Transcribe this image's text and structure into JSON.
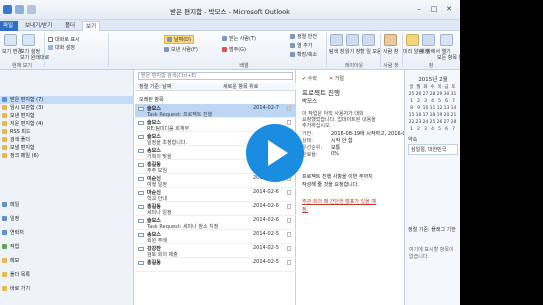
{
  "window": {
    "title": "받은 편지함 - 박모스 - Microsoft Outlook"
  },
  "tabs": {
    "file": "파일",
    "items": [
      "보내기/받기",
      "폴더",
      "보기"
    ]
  },
  "ribbon": {
    "groups": [
      "현재 보기",
      "배열",
      "레이아웃",
      "사람 창",
      "창"
    ],
    "labels": {
      "view_change": "보기 변경",
      "view_settings": "보기 설정",
      "view_reset": "보기 원래대로",
      "conversation": "대화로 표시",
      "conversation_settings": "대화 설정",
      "date": "날짜(D)",
      "sender": "보낸 사람(F)",
      "to": "받는 사람(T)",
      "recipient": "보낸 사람(E)",
      "category": "범주(G)",
      "reverse": "정렬 반전",
      "add_column": "열 추가",
      "expand": "확장/축소",
      "folder_pane": "탐색 창",
      "reading_pane": "읽기 창",
      "todo_bar": "할 일 모음",
      "people_pane": "사람 창",
      "reminders": "미리 알림 창",
      "new_window": "새 창에서 열기",
      "close_all": "모든 항목 닫기"
    }
  },
  "nav": {
    "items": [
      {
        "label": "받은 편지함 (7)",
        "icon": "inbox-icon",
        "selected": true
      },
      {
        "label": "임시 보관함 (3)",
        "icon": "drafts-icon"
      },
      {
        "label": "보낸 편지함",
        "icon": "sent-icon"
      },
      {
        "label": "지운 편지함 (4)",
        "icon": "deleted-icon"
      },
      {
        "label": "RSS 피드",
        "icon": "rss-icon"
      },
      {
        "label": "검색 폴더",
        "icon": "search-folder-icon"
      },
      {
        "label": "보낼 편지함",
        "icon": "outbox-icon"
      },
      {
        "label": "정크 메일 (6)",
        "icon": "junk-icon"
      },
      {
        "label": "메일",
        "icon": "mail-icon"
      },
      {
        "label": "일정",
        "icon": "calendar-icon"
      },
      {
        "label": "연락처",
        "icon": "contacts-icon"
      },
      {
        "label": "작업",
        "icon": "tasks-icon"
      },
      {
        "label": "메모",
        "icon": "notes-icon"
      },
      {
        "label": "폴더 목록",
        "icon": "folder-list-icon"
      },
      {
        "label": "바로 가기",
        "icon": "shortcuts-icon"
      }
    ]
  },
  "list": {
    "search_placeholder": "받은 편지함 검색(Ctrl+E)",
    "header_left": "정렬 기준: 날짜",
    "header_right": "새로운 항목 위로",
    "group_today": "오래된 항목",
    "messages": [
      {
        "from": "슬모스",
        "subject": "Task Request: 프로젝트 진행",
        "date": "2014-02-7",
        "selected": true
      },
      {
        "from": "슬모스",
        "subject": "RE:팀미디움 회계부",
        "date": ""
      },
      {
        "from": "슬모스",
        "subject": "일정을 초청합니다.",
        "date": ""
      },
      {
        "from": "송모스",
        "subject": "기획의 맞을",
        "date": ""
      },
      {
        "from": "홍길동",
        "subject": "주주 모임",
        "date": "2014-02-7"
      },
      {
        "from": "이순신",
        "subject": "여행 일정",
        "date": "2014-02-6"
      },
      {
        "from": "마순신",
        "subject": "학교 안내",
        "date": "2014-02-6"
      },
      {
        "from": "홍길동",
        "subject": "세미나 일정",
        "date": "2014-02-6"
      },
      {
        "from": "슬모스",
        "subject": "Task Request: 세미나 참소 지정",
        "date": "2014-02-6"
      },
      {
        "from": "송모스",
        "subject": "회원 주례",
        "date": "2014-02-5"
      },
      {
        "from": "강강찬",
        "subject": "검토 회의 제출",
        "date": "2014-02-5"
      },
      {
        "from": "홍길동",
        "subject": "",
        "date": "2014-02-5"
      }
    ]
  },
  "reading": {
    "accept": "수락",
    "decline": "거절",
    "title": "프로젝트 진행",
    "sender": "박모스",
    "info1": "이 작업은 아직 사용자가 대외",
    "info2": "요청했었습니다. 업데이트된 내용을",
    "info3": "추가하십시오.",
    "start_label": "기한:",
    "start_value": "2016-08-19에 시작하고, 2016-0",
    "status_label": "상태:",
    "status_value": "시작 안 함",
    "priority_label": "우선순위:",
    "priority_value": "보통",
    "percent_label": "완료율:",
    "percent_value": "0%",
    "body1": "프로젝트 진행 사항을 이번 주까지",
    "body2": "작성해 줄 것을 요청합니다.",
    "body3": "주관 회의 때 간단한 발표가 있을 예",
    "body4": "정."
  },
  "todo": {
    "month": "2015년 2월",
    "weekdays": [
      "일",
      "월",
      "화",
      "수",
      "목",
      "금",
      "토"
    ],
    "weeks": [
      [
        "25",
        "26",
        "27",
        "28",
        "29",
        "30",
        "31"
      ],
      [
        "1",
        "2",
        "3",
        "4",
        "5",
        "6",
        "7"
      ],
      [
        "8",
        "9",
        "10",
        "11",
        "12",
        "13",
        "14"
      ],
      [
        "15",
        "16",
        "17",
        "18",
        "19",
        "20",
        "21"
      ],
      [
        "22",
        "23",
        "24",
        "25",
        "26",
        "27",
        "28"
      ],
      [
        "1",
        "2",
        "3",
        "4",
        "5",
        "6",
        "7"
      ]
    ],
    "tasks_label": "약속",
    "today_label": "삼일절, 대한민국",
    "arrange": "정렬 기준: 플래그 기한",
    "empty_text": "여기에 표시할 항목이 없습니다."
  },
  "colors": {
    "accent": "#2e6fc5",
    "play": "#1a8de0",
    "selection": "#bcd6f4"
  }
}
